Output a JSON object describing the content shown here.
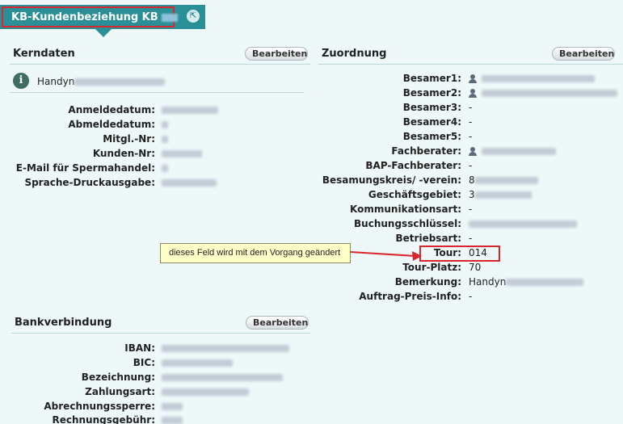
{
  "tab": {
    "title": "KB-Kundenbeziehung KB",
    "close_icon": "back-arrow-icon"
  },
  "kerndaten": {
    "title": "Kerndaten",
    "edit_label": "Bearbeiten",
    "info_text": "Handyn",
    "rows": [
      {
        "label": "Anmeldedatum:",
        "value": ""
      },
      {
        "label": "Abmeldedatum:",
        "value": ""
      },
      {
        "label": "Mitgl.-Nr:",
        "value": ""
      },
      {
        "label": "Kunden-Nr:",
        "value": ""
      },
      {
        "label": "E-Mail für Spermahandel:",
        "value": ""
      },
      {
        "label": "Sprache-Druckausgabe:",
        "value": ""
      }
    ]
  },
  "zuordnung": {
    "title": "Zuordnung",
    "edit_label": "Bearbeiten",
    "rows": [
      {
        "label": "Besamer1:",
        "value": ""
      },
      {
        "label": "Besamer2:",
        "value": ""
      },
      {
        "label": "Besamer3:",
        "value": "-"
      },
      {
        "label": "Besamer4:",
        "value": "-"
      },
      {
        "label": "Besamer5:",
        "value": "-"
      },
      {
        "label": "Fachberater:",
        "value": ""
      },
      {
        "label": "BAP-Fachberater:",
        "value": "-"
      },
      {
        "label": "Besamungskreis/ -verein:",
        "value": "8"
      },
      {
        "label": "Geschäftsgebiet:",
        "value": "3"
      },
      {
        "label": "Kommunikationsart:",
        "value": "-"
      },
      {
        "label": "Buchungsschlüssel:",
        "value": ""
      },
      {
        "label": "Betriebsart:",
        "value": "-"
      },
      {
        "label": "Tour:",
        "value": "014"
      },
      {
        "label": "Tour-Platz:",
        "value": "70"
      },
      {
        "label": "Bemerkung:",
        "value": "Handyn"
      },
      {
        "label": "Auftrag-Preis-Info:",
        "value": "-"
      }
    ]
  },
  "callout": {
    "text": "dieses Feld wird mit dem Vorgang geändert"
  },
  "bankverbindung": {
    "title": "Bankverbindung",
    "edit_label": "Bearbeiten",
    "rows": [
      {
        "label": "IBAN:",
        "value": ""
      },
      {
        "label": "BIC:",
        "value": ""
      },
      {
        "label": "Bezeichnung:",
        "value": ""
      },
      {
        "label": "Zahlungsart:",
        "value": ""
      },
      {
        "label": "Abrechnungssperre:",
        "value": ""
      },
      {
        "label": "Rechnungsgebühr:",
        "value": ""
      }
    ]
  },
  "colors": {
    "accent": "#2a8f96",
    "highlight": "#d9262e",
    "callout_bg": "#ffffc8"
  }
}
